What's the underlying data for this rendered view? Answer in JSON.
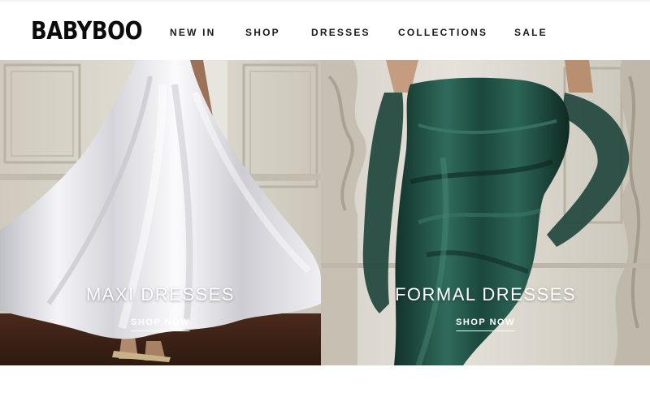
{
  "brand": {
    "logo_text": "BABYBOO"
  },
  "nav": {
    "items": [
      {
        "label": "NEW IN"
      },
      {
        "label": "SHOP"
      },
      {
        "label": "DRESSES"
      },
      {
        "label": "COLLECTIONS"
      },
      {
        "label": "SALE"
      }
    ]
  },
  "hero": {
    "left": {
      "title": "MAXI DRESSES",
      "cta": "SHOP NOW"
    },
    "right": {
      "title": "FORMAL DRESSES",
      "cta": "SHOP NOW"
    }
  },
  "colors": {
    "wall": "#d9d5cb",
    "floor": "#3b2217",
    "white_satin": "#ecebee",
    "emerald": "#1f4a40"
  }
}
